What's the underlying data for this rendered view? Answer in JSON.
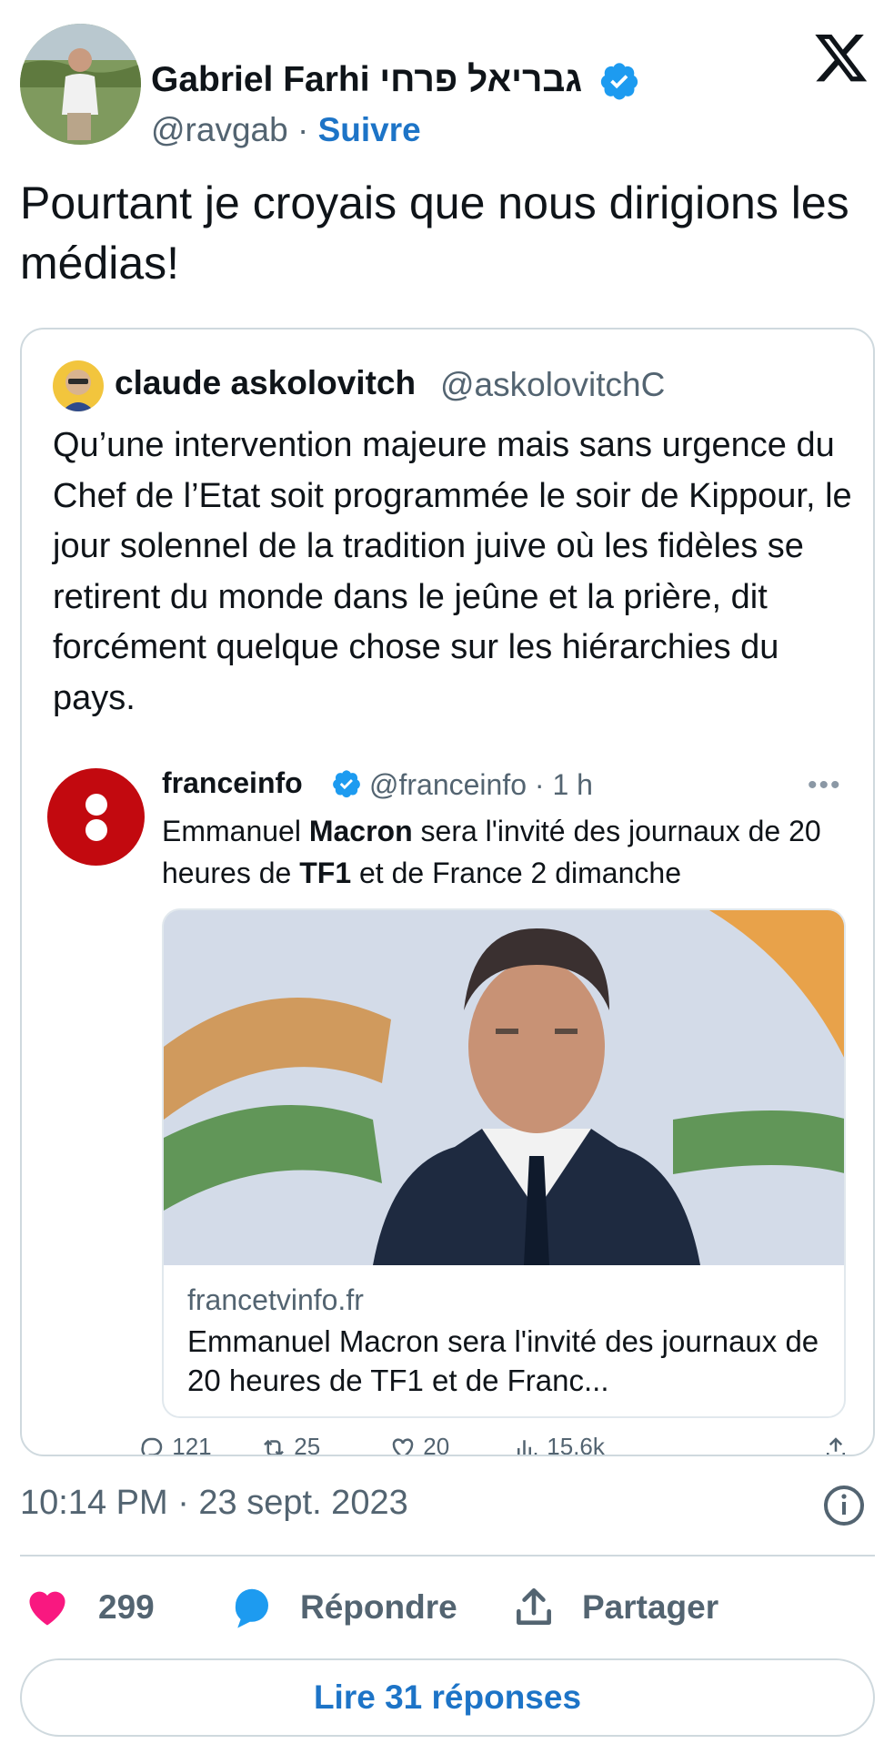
{
  "tweet": {
    "author_name": "Gabriel Farhi גבריאל פרחי",
    "handle": "@ravgab",
    "separator": "·",
    "follow_label": "Suivre",
    "text": "Pourtant je croyais que nous dirigions les médias!",
    "timestamp": "10:14 PM · 23 sept. 2023",
    "likes": "299",
    "reply_label": "Répondre",
    "share_label": "Partager",
    "read_replies_label": "Lire 31 réponses"
  },
  "quoted": {
    "name": "claude askolovitch",
    "handle": "@askolovitchC",
    "text": "Qu’une intervention majeure mais sans urgence du Chef de l’Etat soit programmée le soir de Kippour, le jour solennel de la tradition juive où les fidèles se retirent du monde dans le jeûne et la prière, dit forcément quelque chose sur les hiérarchies du pays.",
    "embedded": {
      "name": "franceinfo",
      "handle_time": "@franceinfo · 1 h",
      "more": "•••",
      "text_parts": [
        "Emmanuel ",
        "Macron",
        " sera l'invité des journaux de 20 heures de ",
        "TF1",
        " et de France 2 dimanche"
      ],
      "link_domain": "francetvinfo.fr",
      "link_title": "Emmanuel Macron sera l'invité des journaux de 20 heures de TF1 et de Franc..."
    },
    "metrics": [
      "121",
      "25",
      "20",
      "15,6k"
    ]
  },
  "colors": {
    "accent": "#1d74c7",
    "verified": "#1d9bf0",
    "like": "#f91880",
    "reply_bubble": "#1d9bf0",
    "franceinfo_red": "#c2090f"
  },
  "icons": [
    "verified-badge-icon",
    "x-logo-icon",
    "more-icon",
    "reply-icon",
    "repost-icon",
    "like-icon",
    "views-icon",
    "share-icon",
    "info-icon",
    "heart-icon",
    "speech-bubble-icon",
    "upload-icon"
  ]
}
